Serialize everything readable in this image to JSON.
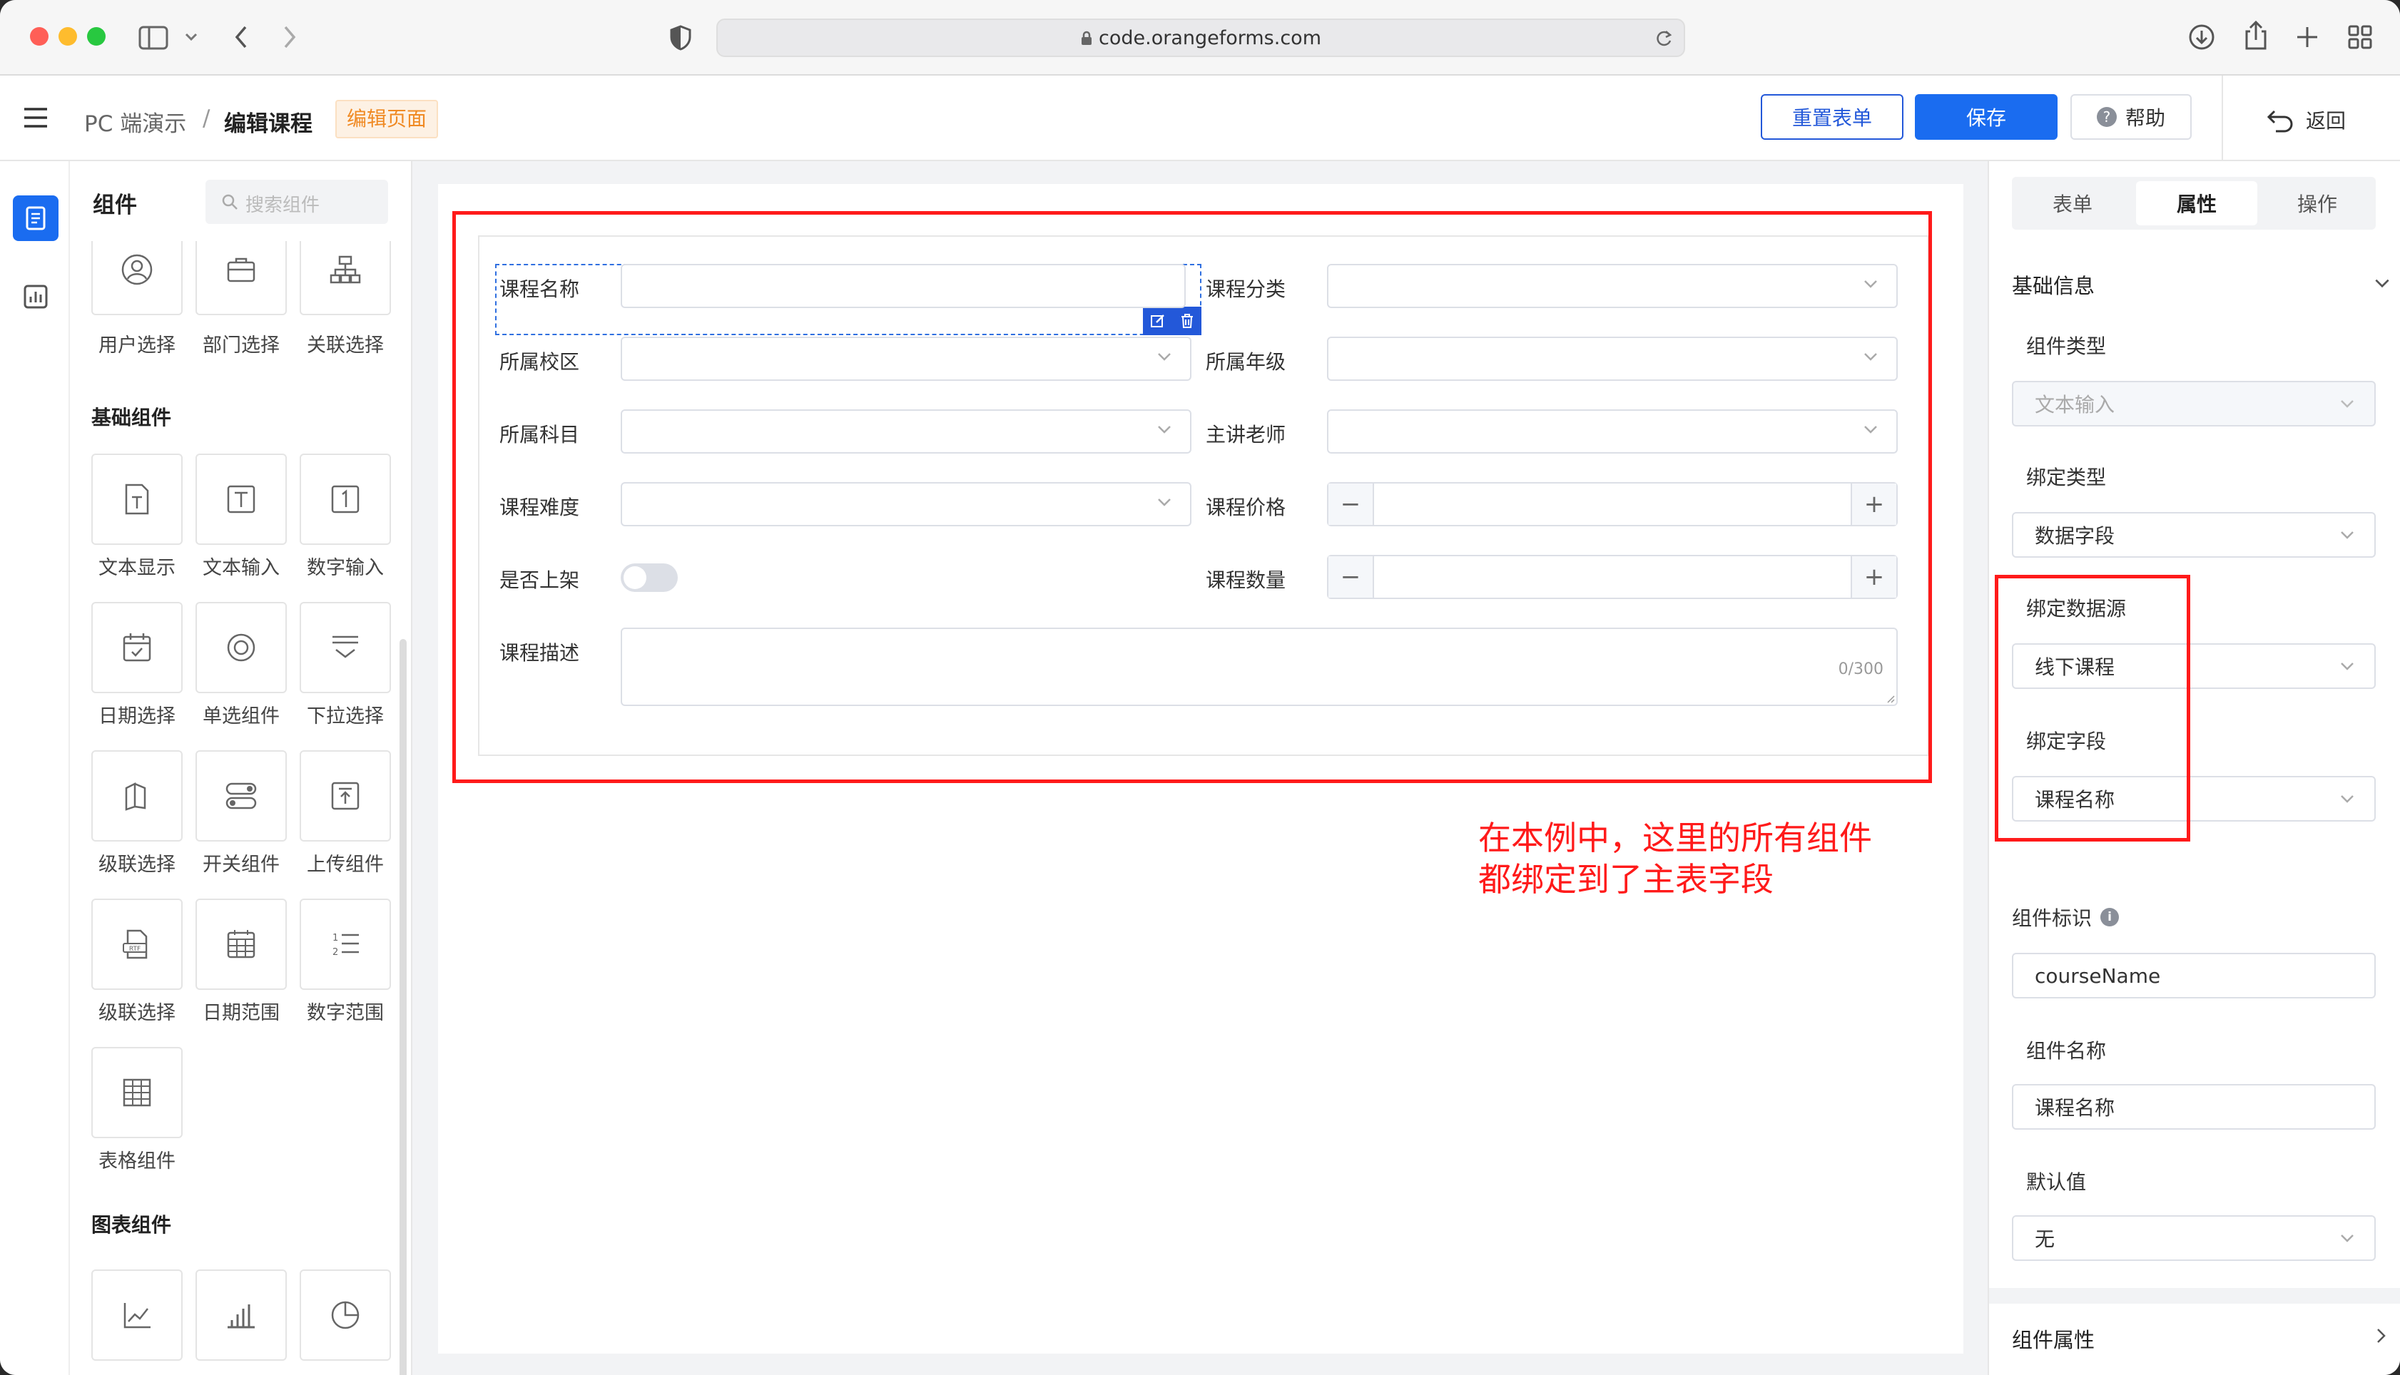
{
  "browser": {
    "url": "code.orangeforms.com"
  },
  "header": {
    "breadcrumb_root": "PC 端演示",
    "breadcrumb_sep": "/",
    "page_title": "编辑课程",
    "mode_tag": "编辑页面",
    "reset_label": "重置表单",
    "save_label": "保存",
    "help_label": "帮助",
    "back_label": "返回"
  },
  "palette": {
    "title": "组件",
    "search_placeholder": "搜索组件",
    "top_items": [
      "用户选择",
      "部门选择",
      "关联选择"
    ],
    "basic_title": "基础组件",
    "basic_items": [
      "文本显示",
      "文本输入",
      "数字输入",
      "日期选择",
      "单选组件",
      "下拉选择",
      "级联选择",
      "开关组件",
      "上传组件",
      "级联选择",
      "日期范围",
      "数字范围",
      "表格组件"
    ],
    "chart_title": "图表组件"
  },
  "form": {
    "fields": {
      "course_name": "课程名称",
      "course_category": "课程分类",
      "campus": "所属校区",
      "grade": "所属年级",
      "subject": "所属科目",
      "teacher": "主讲老师",
      "difficulty": "课程难度",
      "price": "课程价格",
      "on_shelf": "是否上架",
      "quantity": "课程数量",
      "description": "课程描述"
    },
    "desc_counter": "0/300",
    "step_minus": "−",
    "step_plus": "+"
  },
  "annotation": {
    "line1": "在本例中，这里的所有组件",
    "line2": "都绑定到了主表字段",
    "color": "#ff1a1a"
  },
  "panel": {
    "tabs": [
      "表单",
      "属性",
      "操作"
    ],
    "active_tab": "属性",
    "section_basic": "基础信息",
    "component_type_label": "组件类型",
    "component_type_value": "文本输入",
    "bind_type_label": "绑定类型",
    "bind_type_value": "数据字段",
    "bind_source_label": "绑定数据源",
    "bind_source_value": "线下课程",
    "bind_field_label": "绑定字段",
    "bind_field_value": "课程名称",
    "component_id_label": "组件标识",
    "component_id_value": "courseName",
    "component_name_label": "组件名称",
    "component_name_value": "课程名称",
    "default_label": "默认值",
    "default_value": "无",
    "section_attrs": "组件属性"
  },
  "colors": {
    "primary": "#1a6cf0",
    "primary_dark": "#2358d9",
    "tag_orange": "#f08a24"
  }
}
